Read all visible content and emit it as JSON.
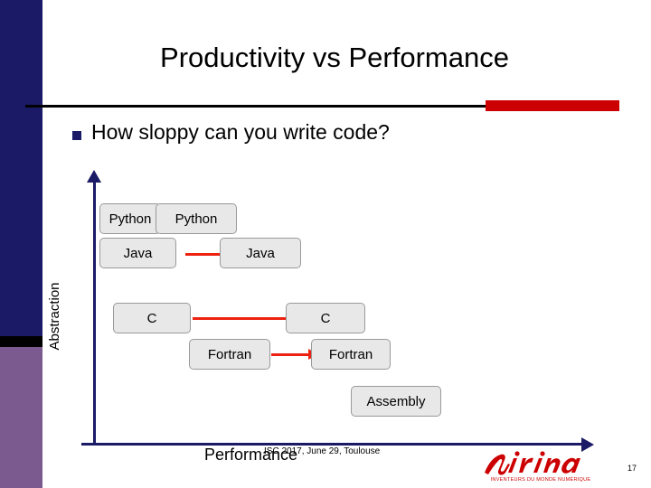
{
  "slide": {
    "title": "Productivity vs Performance",
    "bullet": {
      "marker": "square-bullet",
      "text": "How sloppy can you write code?"
    },
    "page_number": "17",
    "footer": "ISC 2017, June 29, Toulouse",
    "logo": {
      "name": "Inria",
      "tagline": "INVENTEURS DU MONDE NUMÉRIQUE"
    }
  },
  "diagram": {
    "y_axis_label": "Abstraction",
    "x_axis_label": "Performance",
    "boxes": [
      {
        "id": "python-left",
        "label": "Python"
      },
      {
        "id": "python-right",
        "label": "Python"
      },
      {
        "id": "java-left",
        "label": "Java"
      },
      {
        "id": "java-right",
        "label": "Java"
      },
      {
        "id": "c-left",
        "label": "C"
      },
      {
        "id": "c-right",
        "label": "C"
      },
      {
        "id": "fortran-left",
        "label": "Fortran"
      },
      {
        "id": "fortran-right",
        "label": "Fortran"
      },
      {
        "id": "assembly",
        "label": "Assembly"
      }
    ]
  },
  "colors": {
    "accent_dark_blue": "#1a1a66",
    "accent_red": "#cc0000",
    "arrow_red": "#ee2211",
    "box_fill": "#e8e8e8",
    "band_purple": "#7b5b8f"
  }
}
